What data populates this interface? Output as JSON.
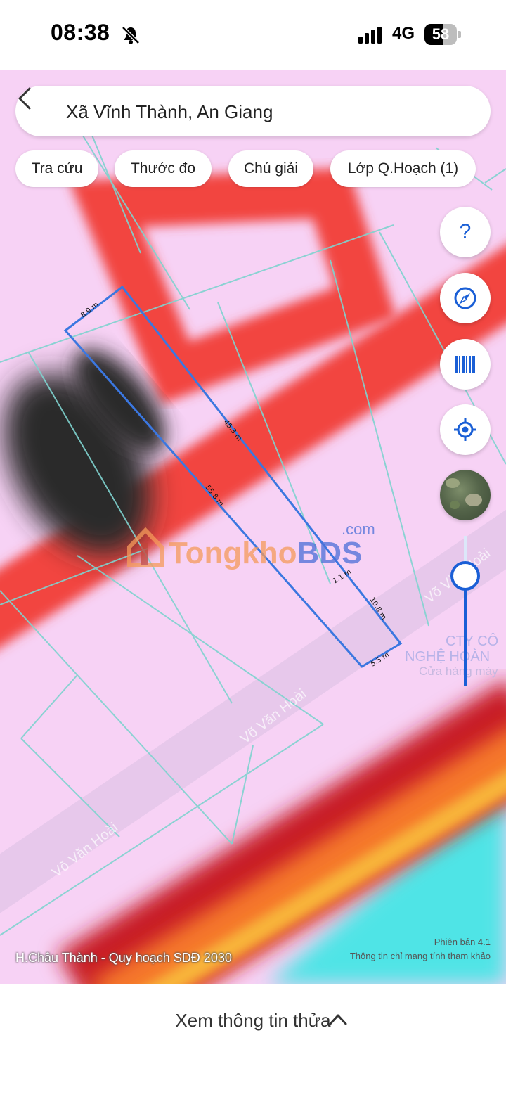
{
  "status_bar": {
    "time": "08:38",
    "network": "4G",
    "battery_level": "58",
    "battery_fraction": 0.58,
    "icons": [
      "bell-slash-icon",
      "signal-icon"
    ]
  },
  "search": {
    "text": "Xã Vĩnh Thành, An Giang",
    "back_icon": "chevron-left-icon"
  },
  "chips": [
    {
      "label": "Tra cứu"
    },
    {
      "label": "Thước đo"
    },
    {
      "label": "Chú giải"
    },
    {
      "label": "Lớp Q.Hoạch (1)"
    }
  ],
  "map_controls": {
    "help_label": "?",
    "icons": [
      "help-icon",
      "compass-icon",
      "barcode-icon",
      "locate-icon",
      "satellite-layer-icon"
    ]
  },
  "parcel": {
    "measurements": [
      "8.9 m",
      "45.3 m",
      "55.8 m",
      "1.1 m",
      "10.8 m",
      "5.5 m"
    ]
  },
  "streets": [
    "Võ Văn Hoài",
    "Võ Văn Hoài",
    "Võ Văn Hoài"
  ],
  "map_labels": {
    "company_line1": "CTY CÔ",
    "company_line2": "NGHỆ HOÀN",
    "company_line3": "Cửa hàng máy"
  },
  "watermark": {
    "brand_a": "Tongkho",
    "brand_b": "BDS",
    "suffix": ".com"
  },
  "map_footer": {
    "plan_name": "H.Châu Thành - Quy hoạch SDĐ 2030",
    "version": "Phiên bản 4.1",
    "disclaimer": "Thông tin chỉ mang tính tham khảo"
  },
  "bottom": {
    "label": "Xem thông tin thửa",
    "icon": "chevron-up-icon"
  },
  "colors": {
    "land_pink": "#f7d2f5",
    "road_red": "#f2453f",
    "accent_blue": "#1a5fd6",
    "water_cyan": "#4fe4e6"
  }
}
